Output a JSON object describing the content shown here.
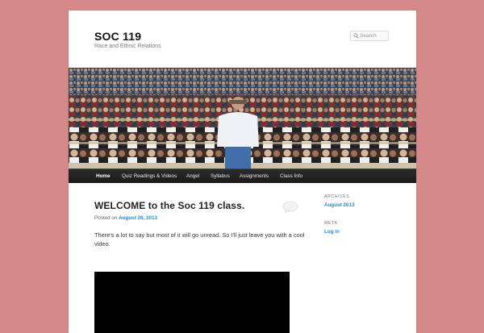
{
  "site": {
    "title": "SOC 119",
    "description": "Race and Ethnic Relations"
  },
  "search": {
    "placeholder": "Search",
    "icon": "magnifier-icon"
  },
  "header_image": {
    "alt": "Lecture hall audience"
  },
  "nav": {
    "items": [
      {
        "label": "Home",
        "current": true
      },
      {
        "label": "Quiz Readings & Videos"
      },
      {
        "label": "Angel"
      },
      {
        "label": "Syllabus"
      },
      {
        "label": "Assignments"
      },
      {
        "label": "Class Info"
      }
    ]
  },
  "post": {
    "title": "WELCOME to the Soc 119 class.",
    "posted_on_prefix": "Posted on",
    "date": "August 26, 2013",
    "content": "There's a lot to say but most of it will go unread. So I'll just leave you with a cool video."
  },
  "sidebar": {
    "archives_title": "ARCHIVES",
    "archives_items": [
      "August 2013"
    ],
    "meta_title": "META",
    "meta_items": [
      "Log in"
    ]
  },
  "colors": {
    "background": "#d58a8a",
    "link": "#1b8be0",
    "nav_bg": "#222222"
  }
}
